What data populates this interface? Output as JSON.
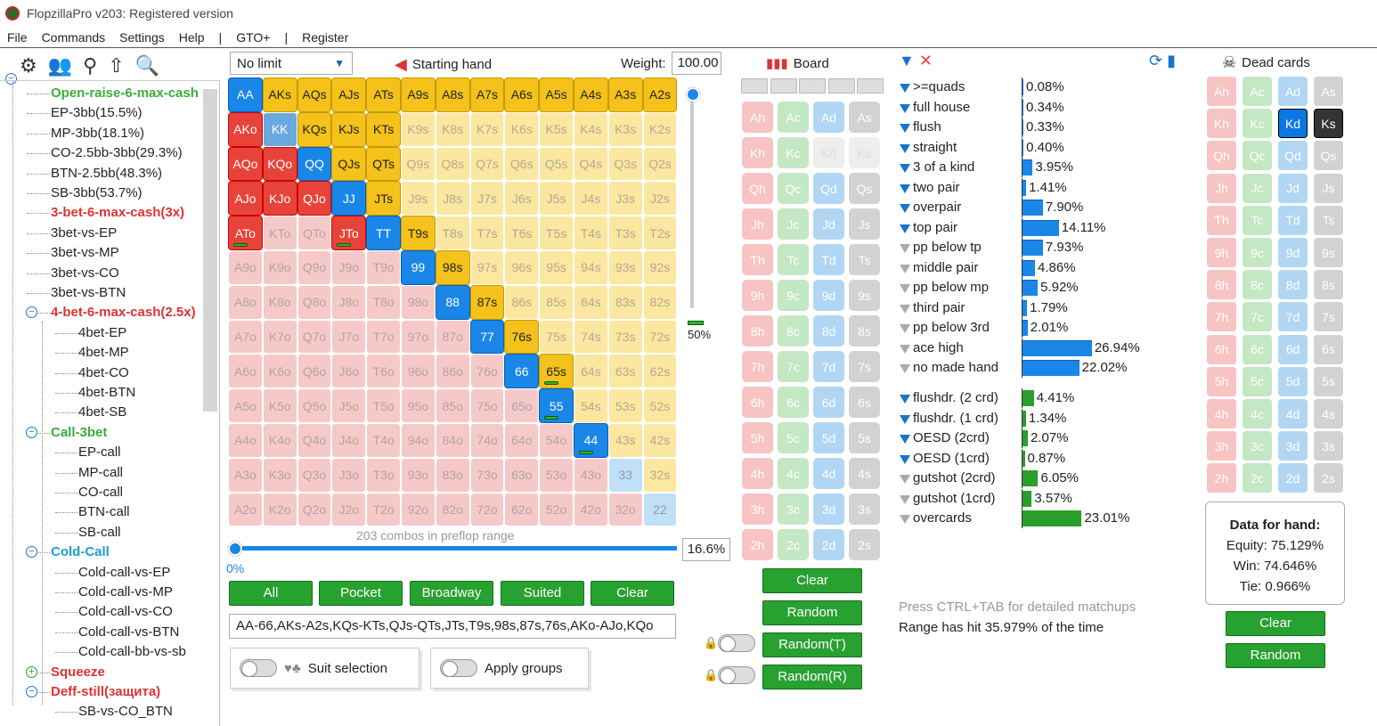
{
  "title": "FlopzillaPro v203: Registered version",
  "menu": [
    "File",
    "Commands",
    "Settings",
    "Help",
    "|",
    "GTO+",
    "|",
    "Register"
  ],
  "tree": [
    {
      "label": "Open-raise-6-max-cash",
      "style": "green",
      "indent": 1,
      "toggle": ""
    },
    {
      "label": "EP-3bb(15.5%)",
      "style": "",
      "indent": 1,
      "toggle": ""
    },
    {
      "label": "MP-3bb(18.1%)",
      "style": "",
      "indent": 1,
      "toggle": ""
    },
    {
      "label": "CO-2.5bb-3bb(29.3%)",
      "style": "",
      "indent": 1,
      "toggle": ""
    },
    {
      "label": "BTN-2.5bb(48.3%)",
      "style": "",
      "indent": 1,
      "toggle": ""
    },
    {
      "label": "SB-3bb(53.7%)",
      "style": "",
      "indent": 1,
      "toggle": ""
    },
    {
      "label": "3-bet-6-max-cash(3x)",
      "style": "red",
      "indent": 1,
      "toggle": ""
    },
    {
      "label": "3bet-vs-EP",
      "style": "",
      "indent": 1,
      "toggle": ""
    },
    {
      "label": "3bet-vs-MP",
      "style": "",
      "indent": 1,
      "toggle": ""
    },
    {
      "label": "3bet-vs-CO",
      "style": "",
      "indent": 1,
      "toggle": ""
    },
    {
      "label": "3bet-vs-BTN",
      "style": "",
      "indent": 1,
      "toggle": ""
    },
    {
      "label": "4-bet-6-max-cash(2.5x)",
      "style": "red",
      "indent": 1,
      "toggle": "minus"
    },
    {
      "label": "4bet-EP",
      "style": "",
      "indent": 2,
      "toggle": ""
    },
    {
      "label": "4bet-MP",
      "style": "",
      "indent": 2,
      "toggle": ""
    },
    {
      "label": "4bet-CO",
      "style": "",
      "indent": 2,
      "toggle": ""
    },
    {
      "label": "4bet-BTN",
      "style": "",
      "indent": 2,
      "toggle": ""
    },
    {
      "label": "4bet-SB",
      "style": "",
      "indent": 2,
      "toggle": ""
    },
    {
      "label": "Call-3bet",
      "style": "green",
      "indent": 1,
      "toggle": "minus"
    },
    {
      "label": "EP-call",
      "style": "",
      "indent": 2,
      "toggle": ""
    },
    {
      "label": "MP-call",
      "style": "",
      "indent": 2,
      "toggle": ""
    },
    {
      "label": "CO-call",
      "style": "",
      "indent": 2,
      "toggle": ""
    },
    {
      "label": "BTN-call",
      "style": "",
      "indent": 2,
      "toggle": ""
    },
    {
      "label": "SB-call",
      "style": "",
      "indent": 2,
      "toggle": ""
    },
    {
      "label": "Cold-Call",
      "style": "cyan",
      "indent": 1,
      "toggle": "minus"
    },
    {
      "label": "Cold-call-vs-EP",
      "style": "",
      "indent": 2,
      "toggle": ""
    },
    {
      "label": "Cold-call-vs-MP",
      "style": "",
      "indent": 2,
      "toggle": ""
    },
    {
      "label": "Cold-call-vs-CO",
      "style": "",
      "indent": 2,
      "toggle": ""
    },
    {
      "label": "Cold-call-vs-BTN",
      "style": "",
      "indent": 2,
      "toggle": ""
    },
    {
      "label": "Cold-call-bb-vs-sb",
      "style": "",
      "indent": 2,
      "toggle": ""
    },
    {
      "label": "Squeeze",
      "style": "red",
      "indent": 1,
      "toggle": "plus"
    },
    {
      "label": "Deff-still(защита)",
      "style": "red",
      "indent": 1,
      "toggle": "minus"
    },
    {
      "label": "SB-vs-CO_BTN",
      "style": "",
      "indent": 2,
      "toggle": ""
    }
  ],
  "range": {
    "game": "No limit",
    "starting_hand": "Starting hand",
    "weight_label": "Weight:",
    "weight_value": "100.00",
    "slider_pct": "50%",
    "combos": "203 combos in preflop range",
    "range_pct": "16.6%",
    "range_low": "0%",
    "buttons": [
      "All",
      "Pocket",
      "Broadway",
      "Suited",
      "Clear"
    ],
    "range_text": "AA-66,AKs-A2s,KQs-KTs,QJs-QTs,JTs,T9s,98s,87s,76s,AKo-AJo,KQo",
    "suit_selection": "Suit selection",
    "apply_groups": "Apply groups",
    "ranks": [
      "A",
      "K",
      "Q",
      "J",
      "T",
      "9",
      "8",
      "7",
      "6",
      "5",
      "4",
      "3",
      "2"
    ],
    "selected": {
      "AA": "b",
      "KK": "kk",
      "QQ": "b",
      "JJ": "b",
      "TT": "b",
      "99": "b",
      "88": "b",
      "77": "b",
      "66": "b",
      "55": "b",
      "44": "b",
      "33": "bl",
      "22": "bl",
      "AKs": "y",
      "AQs": "y",
      "AJs": "y",
      "ATs": "y",
      "A9s": "y",
      "A8s": "y",
      "A7s": "y",
      "A6s": "y",
      "A5s": "y",
      "A4s": "y",
      "A3s": "y",
      "A2s": "y",
      "KQs": "y",
      "KJs": "y",
      "KTs": "y",
      "QJs": "y",
      "QTs": "y",
      "JTs": "y",
      "T9s": "y",
      "98s": "y",
      "87s": "y",
      "76s": "y",
      "65s": "y",
      "AKo": "r",
      "AQo": "r",
      "KQo": "r",
      "AJo": "r",
      "KJo": "r",
      "QJo": "r",
      "ATo": "r",
      "JTo": "r"
    },
    "green_bars": [
      "ATo",
      "JTo",
      "65s",
      "55",
      "44"
    ]
  },
  "board": {
    "header": "Board",
    "rows": [
      "A",
      "K",
      "Q",
      "J",
      "T",
      "9",
      "8",
      "7",
      "6",
      "5",
      "4",
      "3",
      "2"
    ],
    "suits": [
      "h",
      "c",
      "d",
      "s"
    ],
    "buttons": [
      "Clear",
      "Random",
      "Random(T)",
      "Random(R)"
    ]
  },
  "stats": [
    {
      "name": ">=quads",
      "val": "0.08%",
      "pct": 0.08,
      "type": "made",
      "on": true
    },
    {
      "name": "full house",
      "val": "0.34%",
      "pct": 0.34,
      "type": "made",
      "on": true
    },
    {
      "name": "flush",
      "val": "0.33%",
      "pct": 0.33,
      "type": "made",
      "on": true
    },
    {
      "name": "straight",
      "val": "0.40%",
      "pct": 0.4,
      "type": "made",
      "on": true
    },
    {
      "name": "3 of a kind",
      "val": "3.95%",
      "pct": 3.95,
      "type": "made",
      "on": true
    },
    {
      "name": "two pair",
      "val": "1.41%",
      "pct": 1.41,
      "type": "made",
      "on": true
    },
    {
      "name": "overpair",
      "val": "7.90%",
      "pct": 7.9,
      "type": "made",
      "on": true
    },
    {
      "name": "top pair",
      "val": "14.11%",
      "pct": 14.11,
      "type": "made",
      "on": true
    },
    {
      "name": "pp below tp",
      "val": "7.93%",
      "pct": 7.93,
      "type": "made",
      "on": false
    },
    {
      "name": "middle pair",
      "val": "4.86%",
      "pct": 4.86,
      "type": "made",
      "on": false
    },
    {
      "name": "pp below mp",
      "val": "5.92%",
      "pct": 5.92,
      "type": "made",
      "on": false
    },
    {
      "name": "third pair",
      "val": "1.79%",
      "pct": 1.79,
      "type": "made",
      "on": false
    },
    {
      "name": "pp below 3rd",
      "val": "2.01%",
      "pct": 2.01,
      "type": "made",
      "on": false
    },
    {
      "name": "ace high",
      "val": "26.94%",
      "pct": 26.94,
      "type": "made",
      "on": false
    },
    {
      "name": "no made hand",
      "val": "22.02%",
      "pct": 22.02,
      "type": "made",
      "on": false
    },
    {
      "name": "flushdr. (2 crd)",
      "val": "4.41%",
      "pct": 4.41,
      "type": "draw",
      "on": true
    },
    {
      "name": "flushdr. (1 crd)",
      "val": "1.34%",
      "pct": 1.34,
      "type": "draw",
      "on": true
    },
    {
      "name": "OESD (2crd)",
      "val": "2.07%",
      "pct": 2.07,
      "type": "draw",
      "on": true
    },
    {
      "name": "OESD (1crd)",
      "val": "0.87%",
      "pct": 0.87,
      "type": "draw",
      "on": true
    },
    {
      "name": "gutshot (2crd)",
      "val": "6.05%",
      "pct": 6.05,
      "type": "draw",
      "on": false
    },
    {
      "name": "gutshot (1crd)",
      "val": "3.57%",
      "pct": 3.57,
      "type": "draw",
      "on": false
    },
    {
      "name": "overcards",
      "val": "23.01%",
      "pct": 23.01,
      "type": "draw",
      "on": false
    }
  ],
  "press_text": "Press CTRL+TAB for detailed matchups",
  "hit_text": "Range has hit 35.979% of the time",
  "dead": {
    "header": "Dead cards",
    "data_title": "Data for hand:",
    "equity": "Equity: 75.129%",
    "win": "Win: 74.646%",
    "tie": "Tie: 0.966%",
    "buttons": [
      "Clear",
      "Random"
    ]
  },
  "colors": {
    "red": "#e8433a",
    "blue": "#1a86e8",
    "yellow": "#f4c21a",
    "green": "#27a12f"
  }
}
